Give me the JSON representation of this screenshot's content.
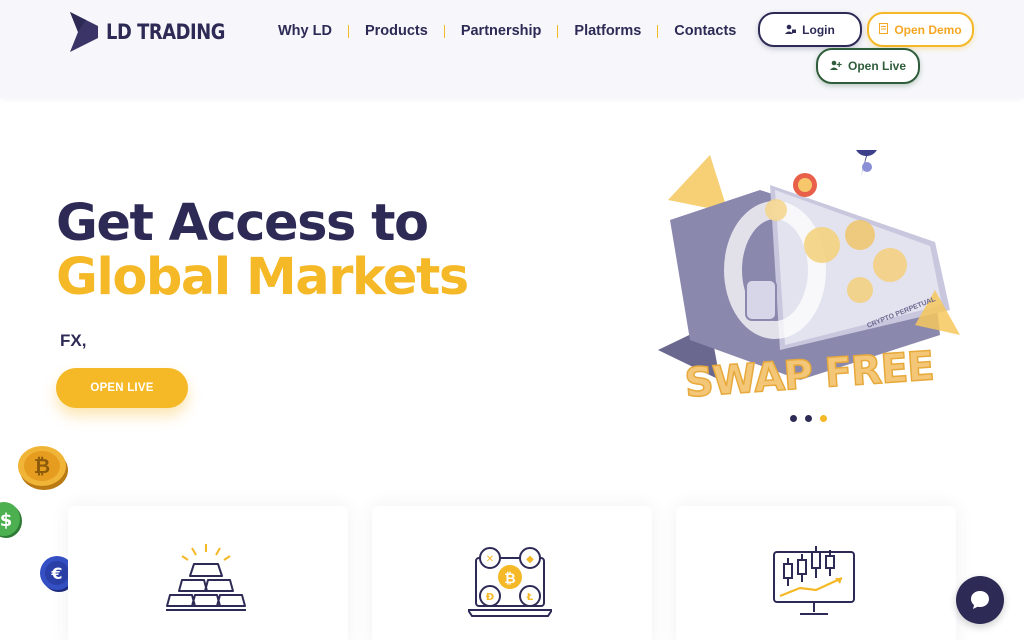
{
  "brand": {
    "name": "LD TRADING"
  },
  "nav": [
    "Why LD",
    "Products",
    "Partnership",
    "Platforms",
    "Contacts"
  ],
  "header_buttons": {
    "login": "Login",
    "open_demo": "Open Demo",
    "open_live": "Open Live"
  },
  "hero": {
    "title_line1": "Get Access to",
    "title_line2": "Global Markets",
    "subtitle": "FX,",
    "cta": "OPEN LIVE"
  },
  "carousel": {
    "art_text": "SWAP FREE",
    "art_label": "CRYPTO PERPETUAL",
    "slides": 3,
    "active_slide": 3
  },
  "feature_cards": [
    {
      "icon": "gold-bars-icon"
    },
    {
      "icon": "crypto-laptop-icon"
    },
    {
      "icon": "candlestick-monitor-icon"
    }
  ],
  "colors": {
    "navy": "#2d2a55",
    "gold": "#f5b827",
    "green": "#2f5d3a"
  },
  "floating_icons": [
    "bitcoin-coin-icon",
    "dollar-coin-icon",
    "euro-coin-icon"
  ],
  "chat": {
    "icon": "chat-bubble-icon"
  }
}
